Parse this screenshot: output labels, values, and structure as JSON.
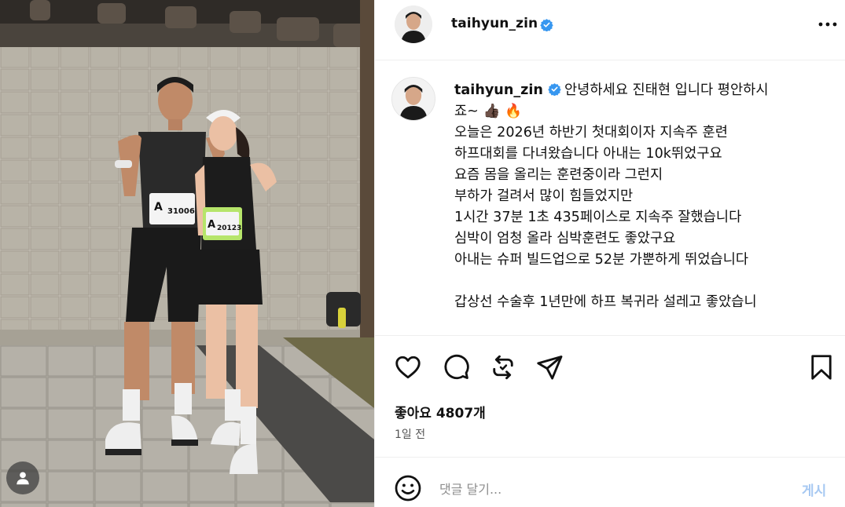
{
  "post": {
    "username": "taihyun_zin",
    "verified": true,
    "icons": {
      "more": "more-options-icon",
      "like": "heart-icon",
      "comment": "comment-bubble-icon",
      "share": "repost-icon",
      "send": "send-paper-plane-icon",
      "save": "bookmark-icon",
      "emoji": "emoji-smiley-icon",
      "tag": "user-tag-icon"
    }
  },
  "caption": {
    "username": "taihyun_zin",
    "first_line": "안녕하세요 진태현 입니다 평안하시",
    "second_line_text": "죠~",
    "emojis": "👍🏿 🔥",
    "lines": [
      "오늘은 2026년 하반기 첫대회이자 지속주 훈련",
      "하프대회를 다녀왔습니다 아내는 10k뛰었구요",
      "요즘 몸을 올리는 훈련중이라 그런지",
      "부하가 걸려서 많이 힘들었지만",
      "1시간 37분 1초 435페이스로 지속주 잘했습니다",
      "심박이 엄청 올라 심박훈련도 좋았구요",
      "아내는 슈퍼 빌드업으로 52분 가뿐하게 뛰었습니다"
    ],
    "after_blank": "갑상선 수술후 1년만에 하프 복귀라 설레고 좋았습니"
  },
  "engagement": {
    "likes": "좋아요 4807개",
    "time_ago": "1일 전"
  },
  "comment_box": {
    "placeholder": "댓글 달기...",
    "post_label": "게시"
  },
  "photo": {
    "bib_left": "31006",
    "bib_right": "20123",
    "bib_letter": "A"
  },
  "colors": {
    "verified_blue": "#3797f0",
    "post_button_disabled": "#a6c8f2",
    "divider": "#efefef"
  }
}
